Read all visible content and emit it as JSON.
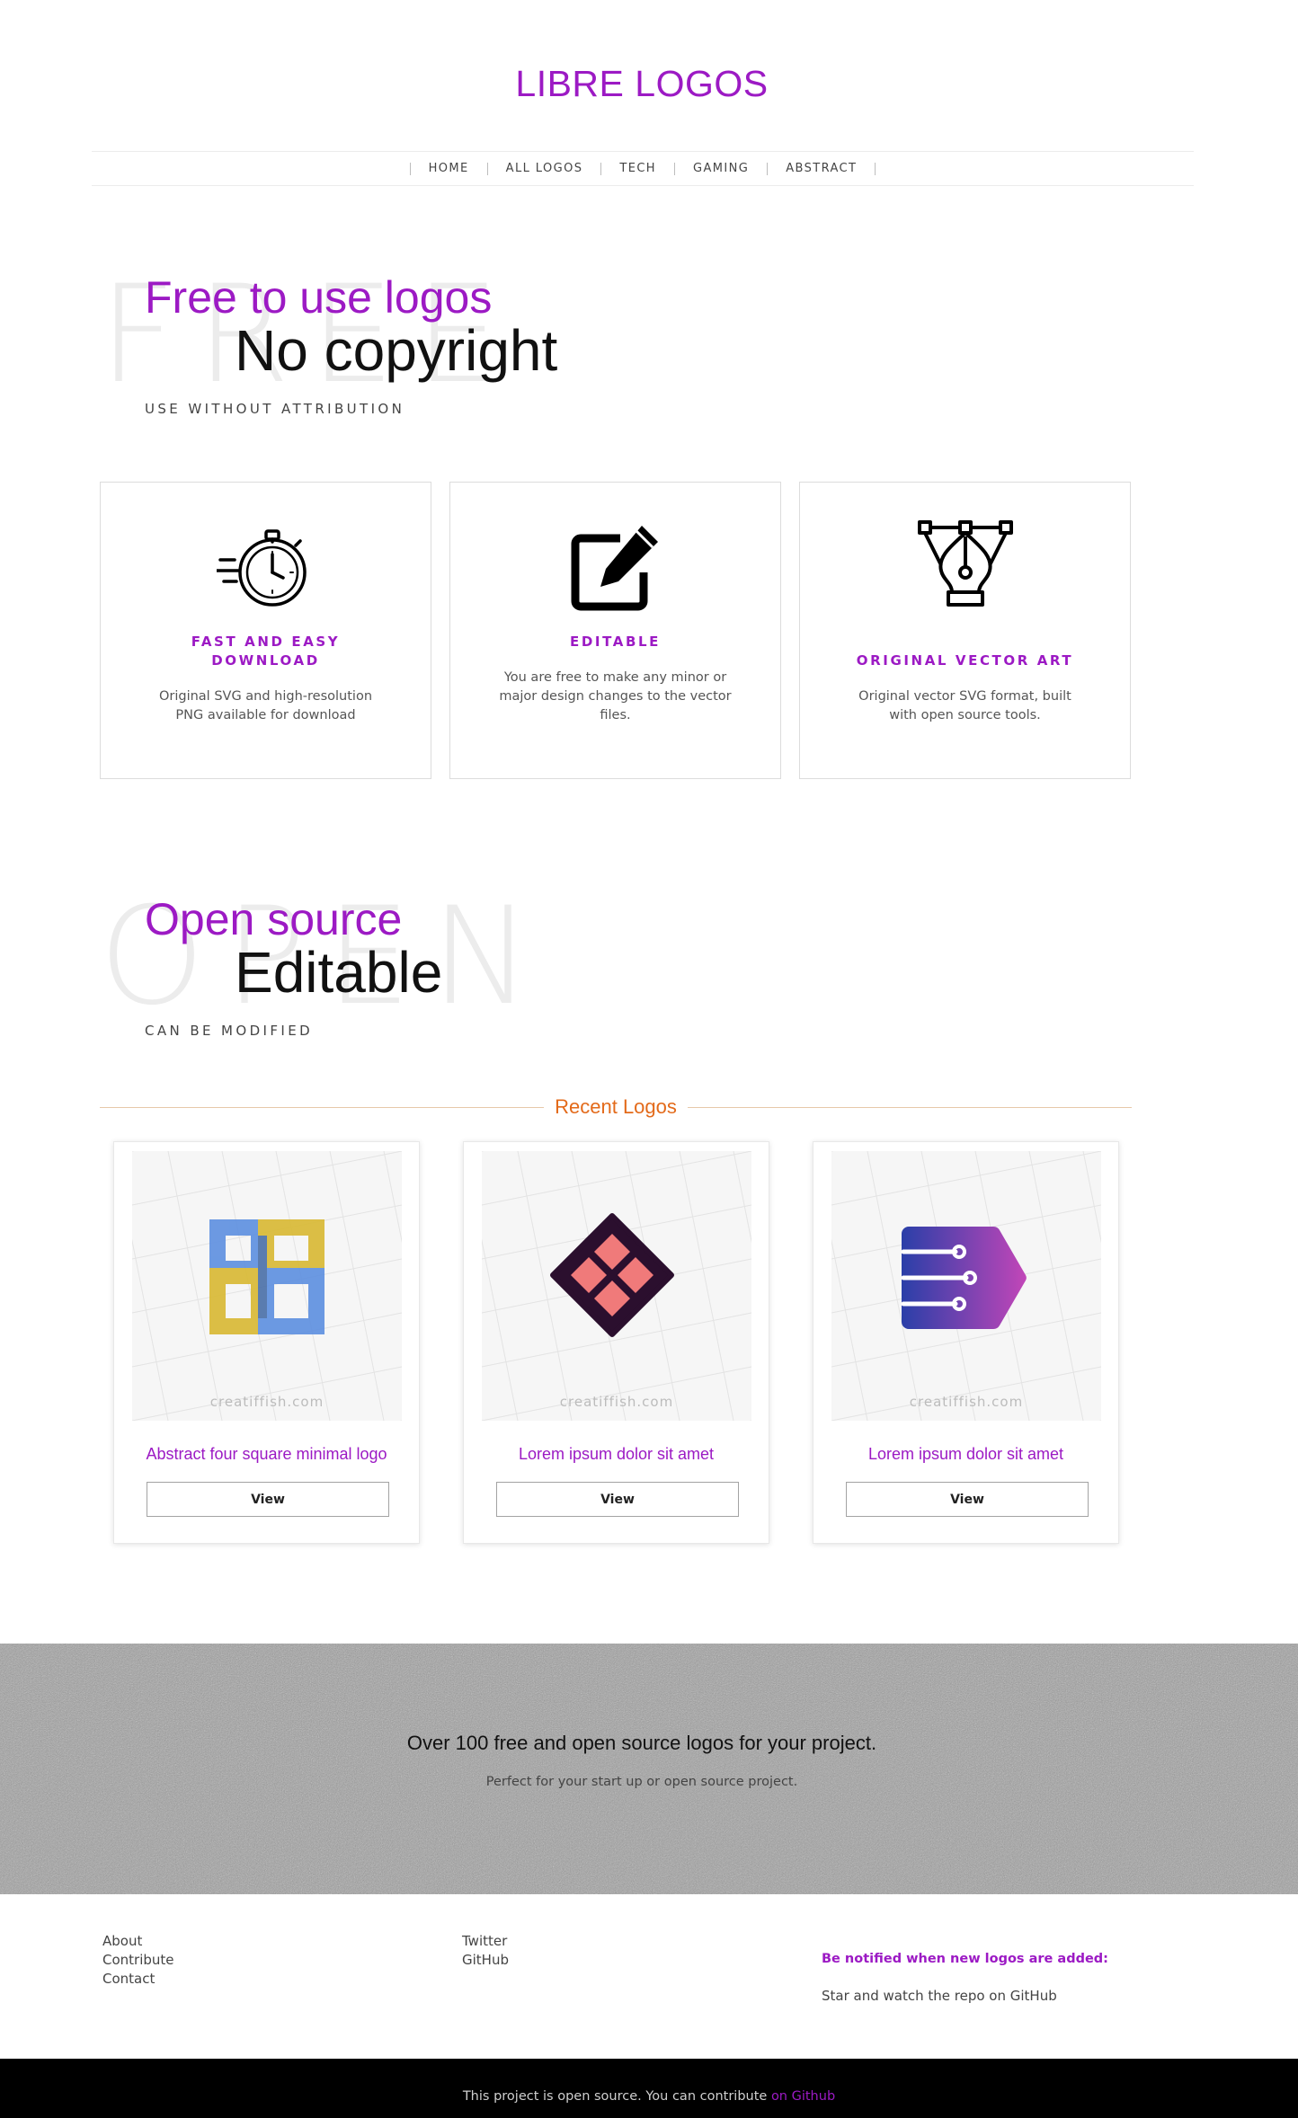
{
  "site": {
    "title": "LIBRE LOGOS"
  },
  "nav": {
    "items": [
      "HOME",
      "ALL LOGOS",
      "TECH",
      "GAMING",
      "ABSTRACT"
    ]
  },
  "hero1": {
    "ghost": "FREE",
    "kicker": "Free to use logos",
    "big": "No copyright",
    "sub": "USE WITHOUT ATTRIBUTION"
  },
  "features": [
    {
      "icon": "stopwatch-icon",
      "title": "FAST AND EASY DOWNLOAD",
      "desc": "Original SVG and high-resolution PNG available for download"
    },
    {
      "icon": "edit-icon",
      "title": "EDITABLE",
      "desc": "You are free to make any minor or major design changes to the vector files."
    },
    {
      "icon": "vector-pen-icon",
      "title": "ORIGINAL VECTOR ART",
      "desc": "Original vector SVG format, built with open source tools."
    }
  ],
  "hero2": {
    "ghost": "OPEN",
    "kicker": "Open source",
    "big": "Editable",
    "sub": "CAN BE MODIFIED"
  },
  "recent": {
    "heading": "Recent Logos",
    "watermark": "creatiffish.com",
    "cards": [
      {
        "title": "Abstract four square minimal logo",
        "button": "View",
        "logo": "four-square-logo"
      },
      {
        "title": "Lorem ipsum dolor sit amet",
        "button": "View",
        "logo": "diamond-logo"
      },
      {
        "title": "Lorem ipsum dolor sit amet",
        "button": "View",
        "logo": "arrow-tech-logo"
      }
    ]
  },
  "banner": {
    "title": "Over 100 free and open source logos for your project.",
    "sub": "Perfect for your start up or open source project."
  },
  "footer": {
    "col1": [
      "About",
      "Contribute",
      "Contact"
    ],
    "col2": [
      "Twitter",
      "GitHub"
    ],
    "notify_title": "Be notified when new logos are added:",
    "notify_text": "Star and watch the repo on GitHub"
  },
  "bottom": {
    "text": "This project is open source. You can contribute ",
    "link": "on Github"
  },
  "colors": {
    "accent": "#9c1ac4",
    "orange": "#e36a1a",
    "black": "#000000"
  }
}
